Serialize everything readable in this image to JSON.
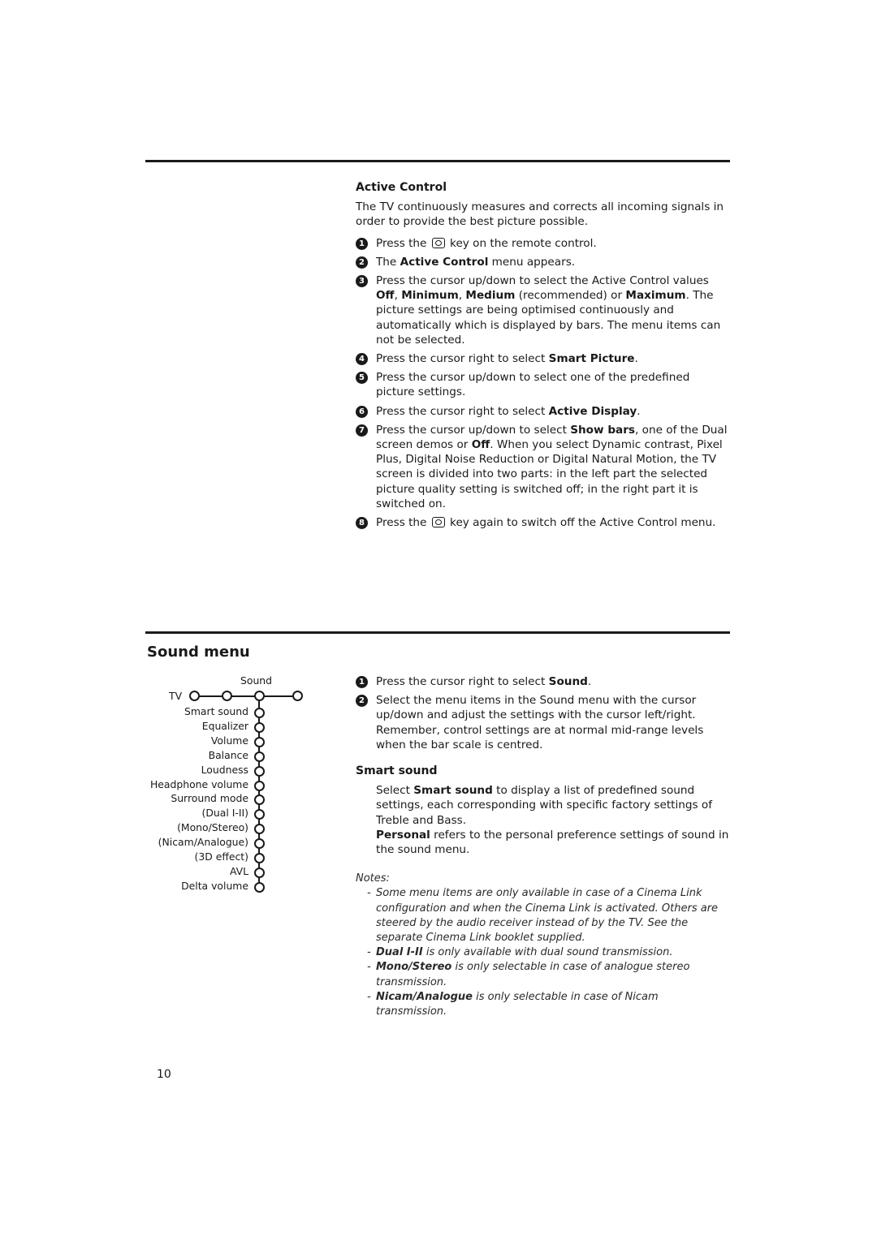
{
  "page_number": "10",
  "active_control": {
    "heading": "Active Control",
    "intro": "The TV continuously measures and corrects all incoming signals in order to provide the best picture possible.",
    "steps": [
      {
        "n": "1",
        "parts": [
          "Press the ",
          "[key]",
          " key on the remote control."
        ]
      },
      {
        "n": "2",
        "parts": [
          "The ",
          "**Active Control",
          " menu appears."
        ]
      },
      {
        "n": "3",
        "parts": [
          "Press the cursor up/down to select the Active Control values ",
          "**Off",
          ", ",
          "**Minimum",
          ", ",
          "**Medium",
          " (recommended) or ",
          "**Maximum",
          ". The picture settings are being optimised continuously and automatically which is displayed by bars. The menu items can not be selected."
        ]
      },
      {
        "n": "4",
        "parts": [
          "Press the cursor right to select ",
          "**Smart Picture",
          "."
        ]
      },
      {
        "n": "5",
        "parts": [
          "Press the cursor up/down to select one of the predefined picture settings."
        ]
      },
      {
        "n": "6",
        "parts": [
          "Press the cursor right to select ",
          "**Active Display",
          "."
        ]
      },
      {
        "n": "7",
        "parts": [
          "Press the cursor up/down to select ",
          "**Show bars",
          ", one of the Dual screen demos or ",
          "**Off",
          ". When you select Dynamic contrast, Pixel Plus, Digital Noise Reduction or Digital Natural Motion, the TV screen is divided into two parts: in the left part the selected picture quality setting is switched off; in the right part it is switched on."
        ]
      },
      {
        "n": "8",
        "parts": [
          "Press the ",
          "[key]",
          " key again to switch off the Active Control menu."
        ]
      }
    ]
  },
  "sound_menu": {
    "heading": "Sound menu",
    "diagram": {
      "top_label": "Sound",
      "root_label": "TV",
      "items": [
        "Smart sound",
        "Equalizer",
        "Volume",
        "Balance",
        "Loudness",
        "Headphone volume",
        "Surround mode",
        "(Dual I-II)",
        "(Mono/Stereo)",
        "(Nicam/Analogue)",
        "(3D effect)",
        "AVL",
        "Delta volume"
      ]
    },
    "steps": [
      {
        "n": "1",
        "parts": [
          "Press the cursor right to select ",
          "**Sound",
          "."
        ]
      },
      {
        "n": "2",
        "parts": [
          "Select the menu items in the Sound menu with the cursor up/down and adjust the settings with the cursor left/right. Remember, control settings are at normal mid-range levels when the bar scale is centred."
        ]
      }
    ],
    "smart_sound": {
      "heading": "Smart sound",
      "parts": [
        "Select ",
        "**Smart sound",
        " to display a list of predefined sound settings, each corresponding with specific factory settings of Treble and Bass."
      ],
      "parts2": [
        "**Personal",
        " refers to the personal preference settings of sound in the sound menu."
      ]
    },
    "notes": {
      "label": "Notes:",
      "items": [
        [
          "Some menu items are only available in case of a Cinema Link configuration and when the Cinema Link is activated. Others are steered by the audio receiver instead of by the TV. See the separate Cinema Link booklet supplied."
        ],
        [
          "**Dual I-II",
          " is only available with dual sound transmission."
        ],
        [
          "**Mono/Stereo",
          " is only selectable in case of analogue stereo transmission."
        ],
        [
          "**Nicam/Analogue",
          " is only selectable in case of Nicam transmission."
        ]
      ]
    }
  }
}
